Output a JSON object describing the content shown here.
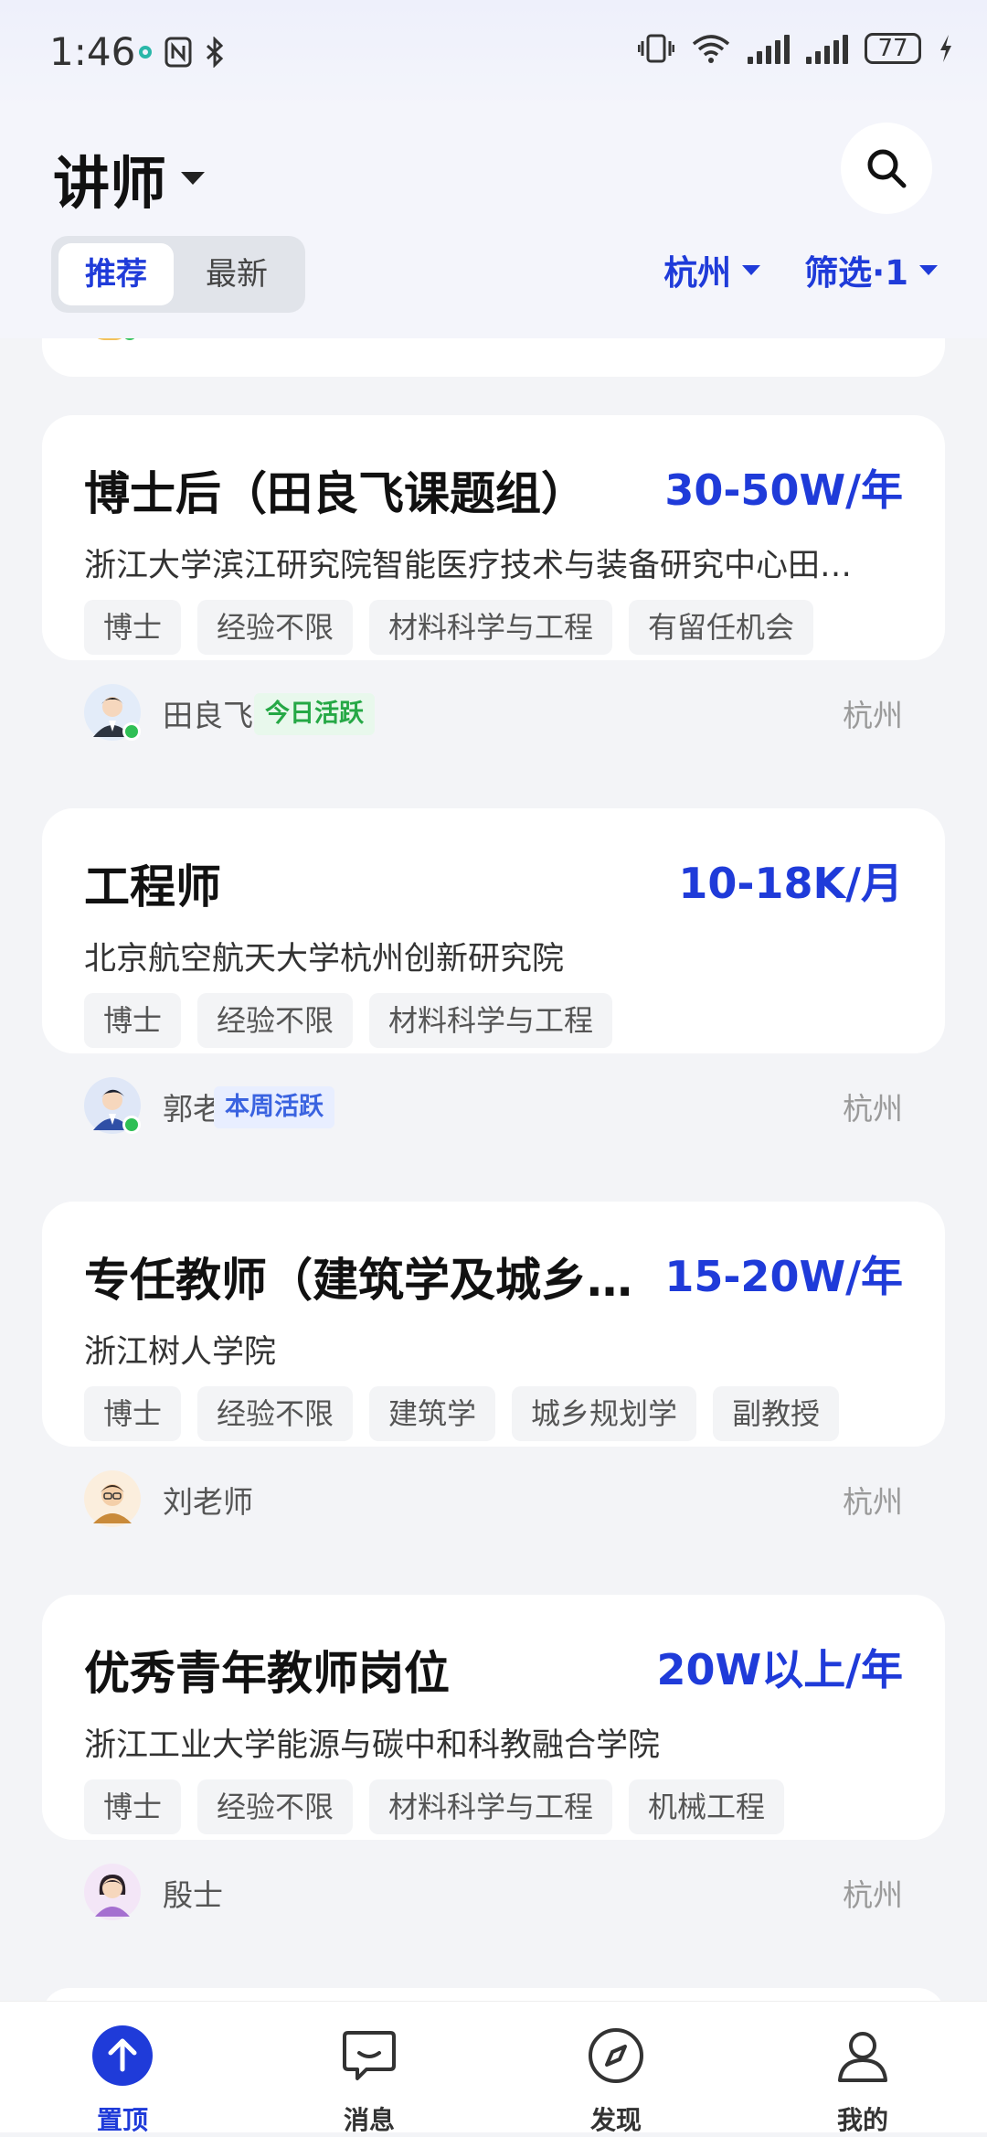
{
  "status_bar": {
    "time": "1:46",
    "battery": "77"
  },
  "header": {
    "title": "讲师",
    "tabs": [
      {
        "label": "推荐",
        "selected": true
      },
      {
        "label": "最新",
        "selected": false
      }
    ],
    "city": "杭州",
    "filter": "筛选·1"
  },
  "jobs": [
    {
      "title": "博士后（田良飞课题组）",
      "salary": "30-50W/年",
      "company": "浙江大学滨江研究院智能医疗技术与装备研究中心田…",
      "tags": [
        "博士",
        "经验不限",
        "材料科学与工程",
        "有留任机会"
      ],
      "person": "田良飞",
      "activity": "今日活跃",
      "city": "杭州"
    },
    {
      "title": "工程师",
      "salary": "10-18K/月",
      "company": "北京航空航天大学杭州创新研究院",
      "tags": [
        "博士",
        "经验不限",
        "材料科学与工程"
      ],
      "person": "郭老师",
      "activity": "本周活跃",
      "city": "杭州"
    },
    {
      "title": "专任教师（建筑学及城乡…",
      "salary": "15-20W/年",
      "company": "浙江树人学院",
      "tags": [
        "博士",
        "经验不限",
        "建筑学",
        "城乡规划学",
        "副教授"
      ],
      "person": "刘老师",
      "city": "杭州"
    },
    {
      "title": "优秀青年教师岗位",
      "salary": "20W以上/年",
      "company": "浙江工业大学能源与碳中和科教融合学院",
      "tags": [
        "博士",
        "经验不限",
        "材料科学与工程",
        "机械工程"
      ],
      "person": "殷士",
      "city": "杭州"
    }
  ],
  "bottom_nav": [
    {
      "label": "置顶",
      "icon": "arrow-up-icon",
      "active": true
    },
    {
      "label": "消息",
      "icon": "message-icon",
      "active": false
    },
    {
      "label": "发现",
      "icon": "compass-icon",
      "active": false
    },
    {
      "label": "我的",
      "icon": "profile-icon",
      "active": false
    }
  ],
  "colors": {
    "accent": "#1f3bd9",
    "online": "#2fbf55"
  }
}
